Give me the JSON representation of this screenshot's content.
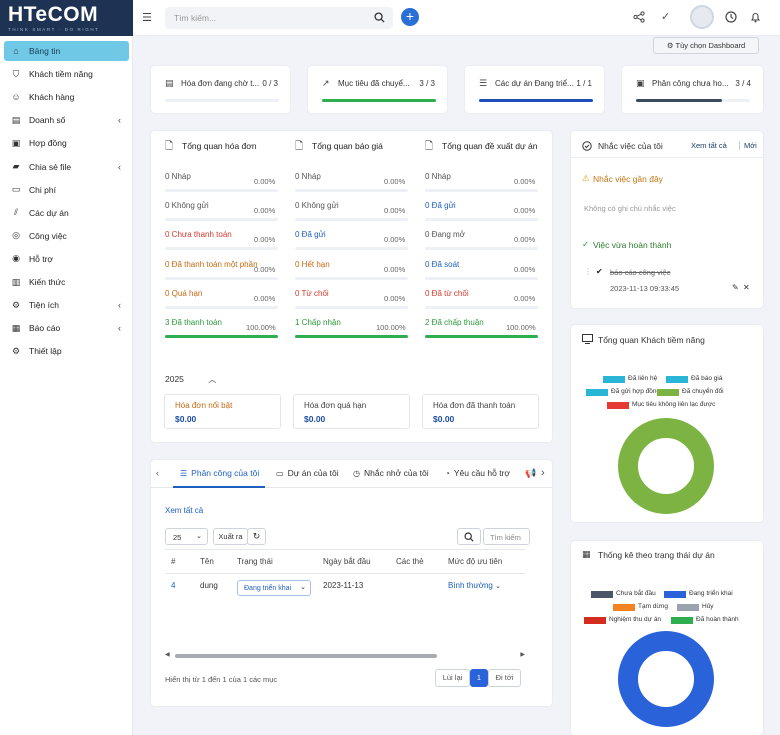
{
  "brand": {
    "logo_text": "HTeCOM",
    "slogan": "THINK SMART · DO RIGHT"
  },
  "sidebar": {
    "items": [
      {
        "label": "Bảng tin",
        "icon": "home-icon",
        "active": true
      },
      {
        "label": "Khách tiềm năng",
        "icon": "funnel-icon"
      },
      {
        "label": "Khách hàng",
        "icon": "user-icon"
      },
      {
        "label": "Doanh số",
        "icon": "invoice-icon",
        "has_sub": true
      },
      {
        "label": "Hợp đồng",
        "icon": "contract-icon"
      },
      {
        "label": "Chia sẻ file",
        "icon": "folder-icon",
        "has_sub": true
      },
      {
        "label": "Chi phí",
        "icon": "receipt-icon"
      },
      {
        "label": "Các dự án",
        "icon": "chart-icon"
      },
      {
        "label": "Công việc",
        "icon": "check-circle-icon"
      },
      {
        "label": "Hỗ trợ",
        "icon": "support-icon"
      },
      {
        "label": "Kiến thức",
        "icon": "book-icon"
      },
      {
        "label": "Tiện ích",
        "icon": "gears-icon",
        "has_sub": true
      },
      {
        "label": "Báo cáo",
        "icon": "report-icon",
        "has_sub": true
      },
      {
        "label": "Thiết lập",
        "icon": "settings-icon"
      }
    ]
  },
  "topbar": {
    "search_placeholder": "Tìm kiếm..."
  },
  "dashboard_options_label": "Tùy chọn Dashboard",
  "stat_cards": [
    {
      "label": "Hóa đơn đang chờ t...",
      "value": "0 / 3",
      "progress": 0,
      "color": "#2a7fd4"
    },
    {
      "label": "Mục tiêu đã chuyể...",
      "value": "3 / 3",
      "progress": 1,
      "color": "#2eae4e"
    },
    {
      "label": "Các dự án Đang triể...",
      "value": "1 / 1",
      "progress": 1,
      "color": "#1d4fb8"
    },
    {
      "label": "Phân công chưa ho...",
      "value": "3 / 4",
      "progress": 0.75,
      "color": "#3a4a5e"
    }
  ],
  "overview": {
    "columns": [
      {
        "title": "Tổng quan hóa đơn",
        "rows": [
          {
            "label": "0 Nháp",
            "pct": "0.00%",
            "cls": "gray"
          },
          {
            "label": "0 Không gửi",
            "pct": "0.00%",
            "cls": "gray"
          },
          {
            "label": "0 Chưa thanh toán",
            "pct": "0.00%",
            "cls": "red"
          },
          {
            "label": "0 Đã thanh toán một phần",
            "pct": "0.00%",
            "cls": "orange"
          },
          {
            "label": "0 Quá hạn",
            "pct": "0.00%",
            "cls": "orange"
          },
          {
            "label": "3 Đã thanh toán",
            "pct": "100.00%",
            "cls": "green"
          }
        ]
      },
      {
        "title": "Tổng quan báo giá",
        "rows": [
          {
            "label": "0 Nháp",
            "pct": "0.00%",
            "cls": "gray"
          },
          {
            "label": "0 Không gửi",
            "pct": "0.00%",
            "cls": "gray"
          },
          {
            "label": "0 Đã gửi",
            "pct": "0.00%",
            "cls": "blue"
          },
          {
            "label": "0 Hết hạn",
            "pct": "0.00%",
            "cls": "orange"
          },
          {
            "label": "0 Từ chối",
            "pct": "0.00%",
            "cls": "red"
          },
          {
            "label": "1 Chấp nhận",
            "pct": "100.00%",
            "cls": "green"
          }
        ]
      },
      {
        "title": "Tổng quan đề xuất dự án",
        "rows": [
          {
            "label": "0 Nháp",
            "pct": "0.00%",
            "cls": "gray"
          },
          {
            "label": "0 Đã gửi",
            "pct": "0.00%",
            "cls": "blue"
          },
          {
            "label": "0 Đang mở",
            "pct": "0.00%",
            "cls": "gray"
          },
          {
            "label": "0 Đã soát",
            "pct": "0.00%",
            "cls": "blue"
          },
          {
            "label": "0 Đã từ chối",
            "pct": "0.00%",
            "cls": "red"
          },
          {
            "label": "2 Đã chấp thuận",
            "pct": "100.00%",
            "cls": "green"
          }
        ]
      }
    ],
    "year": "2025",
    "boxes": [
      {
        "label": "Hóa đơn nổi bật",
        "value": "$0.00"
      },
      {
        "label": "Hóa đơn quá hạn",
        "value": "$0.00"
      },
      {
        "label": "Hóa đơn đã thanh toán",
        "value": "$0.00"
      }
    ]
  },
  "reminders": {
    "title": "Nhắc việc của tôi",
    "view_all": "Xem tất cả",
    "new": "Mới",
    "recent_label": "Nhắc việc gần đây",
    "empty_text": "Không có ghi chú nhắc việc",
    "done_label": "Việc vừa hoàn thành",
    "done_item": "báo cáo công việc",
    "done_time": "2023-11-13 09:33:45"
  },
  "leads_chart": {
    "title": "Tổng quan Khách tiềm năng",
    "legend": [
      {
        "name": "Đã liên hệ",
        "color": "#29b6d6"
      },
      {
        "name": "Đã báo giá",
        "color": "#29b6d6"
      },
      {
        "name": "Đã gửi hợp đồng",
        "color": "#29b6d6"
      },
      {
        "name": "Đã chuyển đổi",
        "color": "#7cb342"
      },
      {
        "name": "Mục tiêu không liên lạc được",
        "color": "#e53935"
      }
    ]
  },
  "project_chart": {
    "title": "Thống kê theo trạng thái dự án",
    "legend": [
      {
        "name": "Chưa bắt đầu",
        "color": "#4a5568"
      },
      {
        "name": "Đang triển khai",
        "color": "#2a62d9"
      },
      {
        "name": "Tạm dừng",
        "color": "#f58220"
      },
      {
        "name": "Hủy",
        "color": "#9aa3ae"
      },
      {
        "name": "Nghiệm thu dự án",
        "color": "#d62b1f"
      },
      {
        "name": "Đã hoàn thành",
        "color": "#2eae4e"
      }
    ]
  },
  "chart_data": [
    {
      "type": "pie",
      "title": "Tổng quan Khách tiềm năng",
      "categories": [
        "Đã liên hệ",
        "Đã báo giá",
        "Đã gửi hợp đồng",
        "Đã chuyển đổi",
        "Mục tiêu không liên lạc được"
      ],
      "values": [
        0,
        0,
        0,
        100,
        0
      ]
    },
    {
      "type": "pie",
      "title": "Thống kê theo trạng thái dự án",
      "categories": [
        "Chưa bắt đầu",
        "Đang triển khai",
        "Tạm dừng",
        "Hủy",
        "Nghiệm thu dự án",
        "Đã hoàn thành"
      ],
      "values": [
        0,
        100,
        0,
        0,
        0,
        0
      ]
    }
  ],
  "tasks_panel": {
    "tabs": [
      "Phân công của tôi",
      "Dự án của tôi",
      "Nhắc nhở của tôi",
      "Yêu cầu hỗ trợ"
    ],
    "view_all": "Xem tất cả",
    "page_size": "25",
    "export_label": "Xuất ra",
    "search_placeholder": "Tìm kiếm",
    "headers": [
      "#",
      "Tên",
      "Trạng thái",
      "Ngày bắt đầu",
      "Các thẻ",
      "Mức độ ưu tiên"
    ],
    "row": {
      "id": "4",
      "name": "dung",
      "status": "Đang triển khai",
      "start": "2023-11-13",
      "priority": "Bình thường"
    },
    "footer": "Hiển thị từ 1 đến 1 của 1 các mục",
    "prev": "Lùi lại",
    "page": "1",
    "next": "Đi tới"
  }
}
